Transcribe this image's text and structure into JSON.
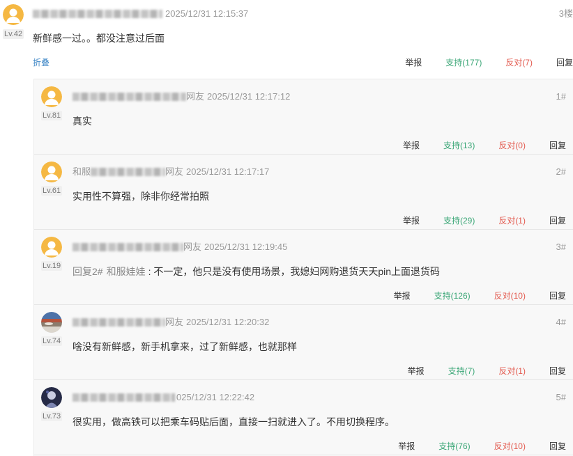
{
  "colors": {
    "support": "#3aa676",
    "oppose": "#e35b50",
    "collapse": "#3d86c6",
    "avatar_default": "#f5b843"
  },
  "comment": {
    "avatar": "default-avatar-icon",
    "level": "Lv.42",
    "time": "2025/12/31 12:15:37",
    "floor": "3楼",
    "content": "新鲜感一过。。都没注意过后面",
    "collapse_label": "折叠",
    "actions": {
      "report": "举报",
      "support": "支持(177)",
      "oppose": "反对(7)",
      "reply": "回复"
    }
  },
  "replies": [
    {
      "avatar": "default-avatar-icon",
      "level": "Lv.81",
      "name_suffix": "网友",
      "time": "2025/12/31 12:17:12",
      "floor": "1#",
      "content": "真实",
      "actions": {
        "report": "举报",
        "support": "支持(13)",
        "oppose": "反对(0)",
        "reply": "回复"
      }
    },
    {
      "avatar": "default-avatar-icon",
      "level": "Lv.61",
      "name_prefix": "和服",
      "name_suffix": "网友",
      "time": "2025/12/31 12:17:17",
      "floor": "2#",
      "content": "实用性不算强，除非你经常拍照",
      "actions": {
        "report": "举报",
        "support": "支持(29)",
        "oppose": "反对(1)",
        "reply": "回复"
      }
    },
    {
      "avatar": "default-avatar-icon",
      "level": "Lv.19",
      "name_suffix": "网友",
      "time": "2025/12/31 12:19:45",
      "floor": "3#",
      "reply_to": {
        "label": "回复2#",
        "name": "和服娃娃"
      },
      "content": ": 不一定，他只是没有使用场景，我媳妇网购退货天天pin上面退货码",
      "actions": {
        "report": "举报",
        "support": "支持(126)",
        "oppose": "反对(10)",
        "reply": "回复"
      }
    },
    {
      "avatar": "photo-avatar-icon",
      "level": "Lv.74",
      "name_suffix": "网友",
      "time": "2025/12/31 12:20:32",
      "floor": "4#",
      "content": "啥没有新鲜感，新手机拿来，过了新鲜感，也就那样",
      "actions": {
        "report": "举报",
        "support": "支持(7)",
        "oppose": "反对(1)",
        "reply": "回复"
      }
    },
    {
      "avatar": "photo-avatar-icon",
      "level": "Lv.73",
      "time": "025/12/31 12:22:42",
      "floor": "5#",
      "content": "很实用，做高铁可以把乘车码贴后面，直接一扫就进入了。不用切换程序。",
      "actions": {
        "report": "举报",
        "support": "支持(76)",
        "oppose": "反对(10)",
        "reply": "回复"
      }
    }
  ]
}
